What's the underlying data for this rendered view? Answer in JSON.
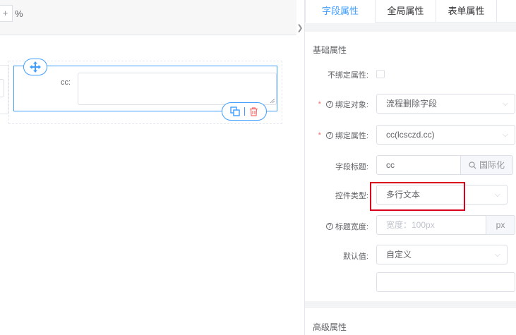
{
  "toolbar": {
    "zoom_plus": "+",
    "zoom_percent": "%"
  },
  "canvas": {
    "field_label": "cc:"
  },
  "tabs": [
    {
      "label": "字段属性",
      "active": true
    },
    {
      "label": "全局属性",
      "active": false
    },
    {
      "label": "表单属性",
      "active": false
    }
  ],
  "basic_section": {
    "title": "基础属性"
  },
  "props": {
    "unbind": {
      "label": "不绑定属性:"
    },
    "bind_object": {
      "label": "绑定对象:",
      "value": "流程删除字段"
    },
    "bind_attr": {
      "label": "绑定属性:",
      "value": "cc(lcsczd.cc)"
    },
    "field_title": {
      "label": "字段标题:",
      "value": "cc",
      "append": "国际化"
    },
    "control_type": {
      "label": "控件类型:",
      "value": "多行文本"
    },
    "title_width": {
      "label": "标题宽度:",
      "placeholder": "宽度：100px",
      "unit": "px"
    },
    "default_value": {
      "label": "默认值:",
      "value": "自定义",
      "custom_value": ""
    }
  },
  "advanced_section": {
    "title": "高级属性"
  },
  "colors": {
    "accent": "#409eff",
    "required": "#f56c6c",
    "highlight": "#d9001b",
    "delete": "#f56c6c"
  },
  "icons": [
    "move-icon",
    "copy-icon",
    "delete-icon",
    "chevron-down-icon",
    "search-icon",
    "help-circle-icon",
    "collapse-arrow-icon"
  ]
}
